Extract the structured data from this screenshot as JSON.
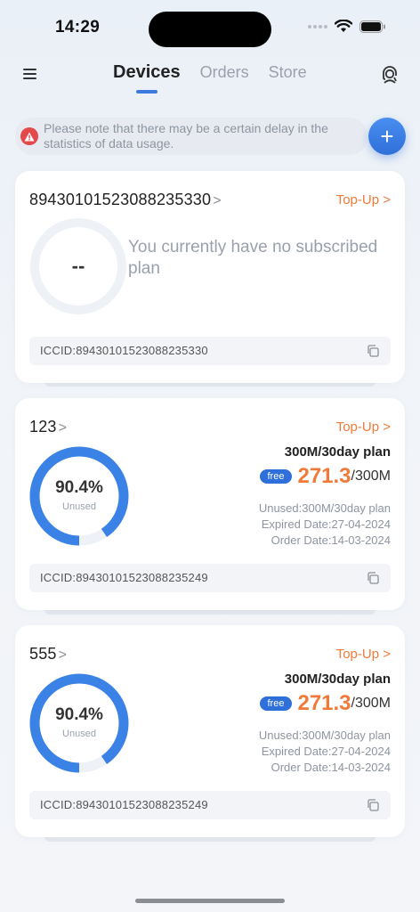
{
  "status": {
    "time": "14:29"
  },
  "nav": {
    "tabs": [
      {
        "label": "Devices",
        "active": true
      },
      {
        "label": "Orders",
        "active": false
      },
      {
        "label": "Store",
        "active": false
      }
    ]
  },
  "notice": {
    "text": "Please note that there may be a certain delay in the statistics of data usage."
  },
  "add_label": "+",
  "colors": {
    "accent": "#2f6fd9",
    "topup": "#f07a3a",
    "ring": "#3a82e6",
    "warn": "#e3484a"
  },
  "devices": [
    {
      "name": "89430101523088235330",
      "topup": "Top-Up >",
      "ring_text": "--",
      "no_plan": "You currently have no subscribed plan",
      "iccid": "ICCID:89430101523088235330"
    },
    {
      "name": "123",
      "topup": "Top-Up >",
      "percent": "90.4%",
      "percent_value": 0.904,
      "unused_label": "Unused",
      "plan": "300M/30day plan",
      "badge": "free",
      "remaining": "271.3",
      "total": "/300M",
      "unused_detail": "Unused:300M/30day plan",
      "expired": "Expired Date:27-04-2024",
      "order": "Order Date:14-03-2024",
      "iccid": "ICCID:89430101523088235249"
    },
    {
      "name": "555",
      "topup": "Top-Up >",
      "percent": "90.4%",
      "percent_value": 0.904,
      "unused_label": "Unused",
      "plan": "300M/30day plan",
      "badge": "free",
      "remaining": "271.3",
      "total": "/300M",
      "unused_detail": "Unused:300M/30day plan",
      "expired": "Expired Date:27-04-2024",
      "order": "Order Date:14-03-2024",
      "iccid": "ICCID:89430101523088235249"
    }
  ]
}
